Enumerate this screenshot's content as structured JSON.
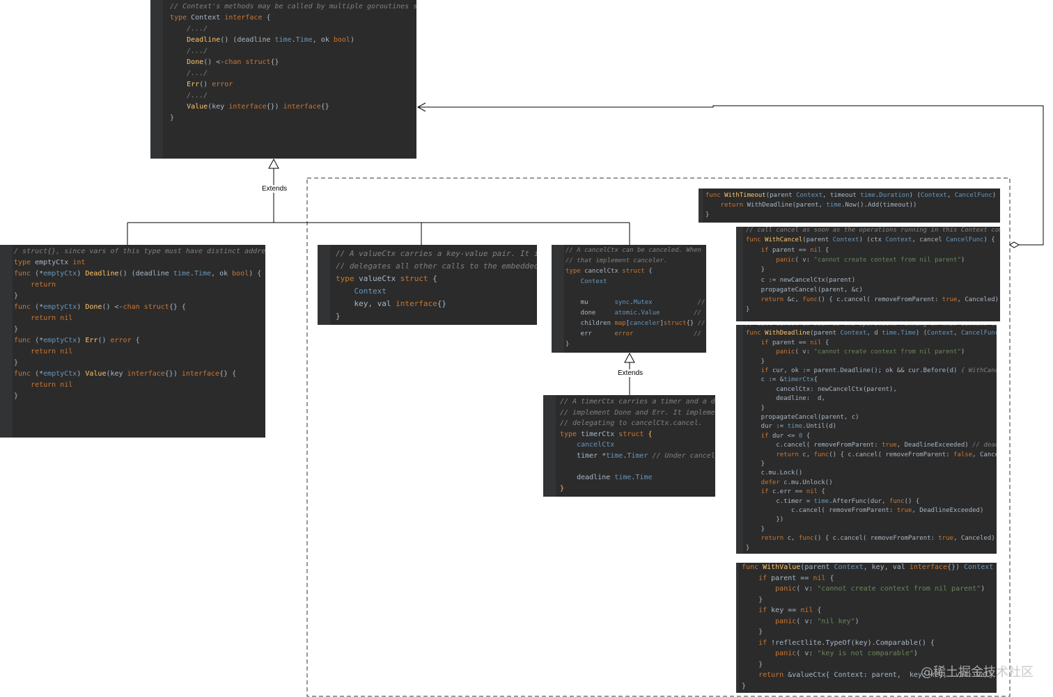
{
  "colors": {
    "panel_bg": "#2b2b2b",
    "comment": "#808080",
    "keyword": "#cc7832",
    "function": "#ffc66d",
    "type": "#6897bb",
    "plain": "#a9b7c6",
    "string": "#6a8759"
  },
  "labels": {
    "extends_top": "Extends",
    "extends_bottom": "Extends"
  },
  "watermark": "@稀土掘金技术社区",
  "panels": {
    "context_interface": [
      [
        [
          "c",
          "// Context's methods may be called by multiple goroutines si"
        ]
      ],
      [
        [
          "k",
          "type "
        ],
        [
          "p",
          "Context "
        ],
        [
          "k",
          "interface "
        ],
        [
          "p",
          "{"
        ]
      ],
      [
        [
          "c",
          "    /.../"
        ]
      ],
      [
        [
          "p",
          "    "
        ],
        [
          "f",
          "Deadline"
        ],
        [
          "p",
          "() (deadline "
        ],
        [
          "t",
          "time"
        ],
        [
          "p",
          "."
        ],
        [
          "t",
          "Time"
        ],
        [
          "p",
          ", ok "
        ],
        [
          "k",
          "bool"
        ],
        [
          "p",
          ")"
        ]
      ],
      [
        [
          "c",
          "    /.../"
        ]
      ],
      [
        [
          "p",
          "    "
        ],
        [
          "f",
          "Done"
        ],
        [
          "p",
          "() <-"
        ],
        [
          "k",
          "chan struct"
        ],
        [
          "p",
          "{}"
        ]
      ],
      [
        [
          "c",
          "    /.../"
        ]
      ],
      [
        [
          "p",
          "    "
        ],
        [
          "f",
          "Err"
        ],
        [
          "p",
          "() "
        ],
        [
          "k",
          "error"
        ]
      ],
      [
        [
          "c",
          "    /.../"
        ]
      ],
      [
        [
          "p",
          "    "
        ],
        [
          "f",
          "Value"
        ],
        [
          "p",
          "(key "
        ],
        [
          "k",
          "interface"
        ],
        [
          "p",
          "{}) "
        ],
        [
          "k",
          "interface"
        ],
        [
          "p",
          "{}"
        ]
      ],
      [
        [
          "p",
          "}"
        ]
      ]
    ],
    "empty_ctx": [
      [
        [
          "c",
          "/ struct{}, since vars of this type must have distinct addresse"
        ]
      ],
      [
        [
          "k",
          "type "
        ],
        [
          "p",
          "emptyCtx "
        ],
        [
          "k",
          "int"
        ]
      ],
      [
        [
          "k",
          "func "
        ],
        [
          "p",
          "(*"
        ],
        [
          "t",
          "emptyCtx"
        ],
        [
          "p",
          ") "
        ],
        [
          "f",
          "Deadline"
        ],
        [
          "p",
          "() (deadline "
        ],
        [
          "t",
          "time"
        ],
        [
          "p",
          "."
        ],
        [
          "t",
          "Time"
        ],
        [
          "p",
          ", ok "
        ],
        [
          "k",
          "bool"
        ],
        [
          "p",
          ") {"
        ]
      ],
      [
        [
          "k",
          "    return"
        ]
      ],
      [
        [
          "p",
          "}"
        ]
      ],
      [
        [
          "k",
          "func "
        ],
        [
          "p",
          "(*"
        ],
        [
          "t",
          "emptyCtx"
        ],
        [
          "p",
          ") "
        ],
        [
          "f",
          "Done"
        ],
        [
          "p",
          "() <-"
        ],
        [
          "k",
          "chan struct"
        ],
        [
          "p",
          "{} {"
        ]
      ],
      [
        [
          "k",
          "    return nil"
        ]
      ],
      [
        [
          "p",
          "}"
        ]
      ],
      [
        [
          "k",
          "func "
        ],
        [
          "p",
          "(*"
        ],
        [
          "t",
          "emptyCtx"
        ],
        [
          "p",
          ") "
        ],
        [
          "f",
          "Err"
        ],
        [
          "p",
          "() "
        ],
        [
          "k",
          "error "
        ],
        [
          "p",
          "{"
        ]
      ],
      [
        [
          "k",
          "    return nil"
        ]
      ],
      [
        [
          "p",
          "}"
        ]
      ],
      [
        [
          "k",
          "func "
        ],
        [
          "p",
          "(*"
        ],
        [
          "t",
          "emptyCtx"
        ],
        [
          "p",
          ") "
        ],
        [
          "f",
          "Value"
        ],
        [
          "p",
          "(key "
        ],
        [
          "k",
          "interface"
        ],
        [
          "p",
          "{}) "
        ],
        [
          "k",
          "interface"
        ],
        [
          "p",
          "{} {"
        ]
      ],
      [
        [
          "k",
          "    return nil"
        ]
      ],
      [
        [
          "p",
          "}"
        ]
      ]
    ],
    "value_ctx": [
      [
        [
          "c",
          "// A valueCtx carries a key-value pair. It i"
        ]
      ],
      [
        [
          "c",
          "// delegates all other calls to the embedded"
        ]
      ],
      [
        [
          "k",
          "type "
        ],
        [
          "p",
          "valueCtx "
        ],
        [
          "k",
          "struct "
        ],
        [
          "p",
          "{"
        ]
      ],
      [
        [
          "t",
          "    Context"
        ]
      ],
      [
        [
          "p",
          "    key, val "
        ],
        [
          "k",
          "interface"
        ],
        [
          "p",
          "{}"
        ]
      ],
      [
        [
          "p",
          "}"
        ]
      ]
    ],
    "cancel_ctx": [
      [
        [
          "c",
          "// A cancelCtx can be canceled. When"
        ]
      ],
      [
        [
          "c",
          "// that implement canceler."
        ]
      ],
      [
        [
          "k",
          "type "
        ],
        [
          "p",
          "cancelCtx "
        ],
        [
          "k",
          "struct "
        ],
        [
          "p",
          "{"
        ]
      ],
      [
        [
          "t",
          "    Context"
        ]
      ],
      [
        [
          "p",
          ""
        ]
      ],
      [
        [
          "p",
          "    mu       "
        ],
        [
          "t",
          "sync"
        ],
        [
          "p",
          "."
        ],
        [
          "t",
          "Mutex"
        ],
        [
          "c",
          "            //"
        ]
      ],
      [
        [
          "p",
          "    done     "
        ],
        [
          "t",
          "atomic"
        ],
        [
          "p",
          "."
        ],
        [
          "t",
          "Value"
        ],
        [
          "c",
          "         //"
        ]
      ],
      [
        [
          "p",
          "    children "
        ],
        [
          "k",
          "map"
        ],
        [
          "p",
          "["
        ],
        [
          "t",
          "canceler"
        ],
        [
          "p",
          "]"
        ],
        [
          "k",
          "struct"
        ],
        [
          "p",
          "{} "
        ],
        [
          "c",
          "//"
        ]
      ],
      [
        [
          "p",
          "    err      "
        ],
        [
          "k",
          "error"
        ],
        [
          "c",
          "                //"
        ]
      ],
      [
        [
          "p",
          "}"
        ]
      ]
    ],
    "timer_ctx": [
      [
        [
          "c",
          "// A timerCtx carries a timer and a dea"
        ]
      ],
      [
        [
          "c",
          "// implement Done and Err. It implement"
        ]
      ],
      [
        [
          "c",
          "// delegating to cancelCtx.cancel."
        ]
      ],
      [
        [
          "k",
          "type "
        ],
        [
          "p",
          "timerCtx "
        ],
        [
          "k",
          "struct "
        ],
        [
          "f",
          "{"
        ]
      ],
      [
        [
          "t",
          "    cancelCtx"
        ]
      ],
      [
        [
          "p",
          "    timer *"
        ],
        [
          "t",
          "time"
        ],
        [
          "p",
          "."
        ],
        [
          "t",
          "Timer"
        ],
        [
          "c",
          " // Under cancelCt"
        ]
      ],
      [
        [
          "p",
          ""
        ]
      ],
      [
        [
          "p",
          "    deadline "
        ],
        [
          "t",
          "time"
        ],
        [
          "p",
          "."
        ],
        [
          "t",
          "Time"
        ]
      ],
      [
        [
          "f",
          "}"
        ]
      ]
    ],
    "with_timeout": [
      [
        [
          "k",
          "func "
        ],
        [
          "f",
          "WithTimeout"
        ],
        [
          "p",
          "(parent "
        ],
        [
          "t",
          "Context"
        ],
        [
          "p",
          ", timeout "
        ],
        [
          "t",
          "time"
        ],
        [
          "p",
          "."
        ],
        [
          "t",
          "Duration"
        ],
        [
          "p",
          ") ("
        ],
        [
          "t",
          "Context"
        ],
        [
          "p",
          ", "
        ],
        [
          "t",
          "CancelFunc"
        ],
        [
          "p",
          ") {"
        ]
      ],
      [
        [
          "k",
          "    return "
        ],
        [
          "p",
          "WithDeadline(parent, "
        ],
        [
          "t",
          "time"
        ],
        [
          "p",
          ".Now().Add(timeout))"
        ]
      ],
      [
        [
          "p",
          "}"
        ]
      ]
    ],
    "with_cancel": [
      [
        [
          "c",
          "// call cancel as soon as the operations running in this Context com"
        ]
      ],
      [
        [
          "k",
          "func "
        ],
        [
          "f",
          "WithCancel"
        ],
        [
          "p",
          "(parent "
        ],
        [
          "t",
          "Context"
        ],
        [
          "p",
          ") (ctx "
        ],
        [
          "t",
          "Context"
        ],
        [
          "p",
          ", cancel "
        ],
        [
          "t",
          "CancelFunc"
        ],
        [
          "p",
          ") {"
        ]
      ],
      [
        [
          "k",
          "    if "
        ],
        [
          "p",
          "parent == "
        ],
        [
          "k",
          "nil "
        ],
        [
          "p",
          "{"
        ]
      ],
      [
        [
          "k",
          "        panic"
        ],
        [
          "p",
          "( v: "
        ],
        [
          "s",
          "\"cannot create context from nil parent\""
        ],
        [
          "p",
          ")"
        ]
      ],
      [
        [
          "p",
          "    }"
        ]
      ],
      [
        [
          "p",
          "    c := newCancelCtx(parent)"
        ]
      ],
      [
        [
          "p",
          "    propagateCancel(parent, &c)"
        ]
      ],
      [
        [
          "k",
          "    return "
        ],
        [
          "p",
          "&c, "
        ],
        [
          "k",
          "func"
        ],
        [
          "p",
          "() { c.cancel( removeFromParent: "
        ],
        [
          "k",
          "true"
        ],
        [
          "p",
          ", Canceled) }"
        ]
      ],
      [
        [
          "p",
          "}"
        ]
      ]
    ],
    "with_deadline": [
      [
        [
          "c",
          "// call cancel as soon as the operations running in this Context complete"
        ]
      ],
      [
        [
          "k",
          "func "
        ],
        [
          "f",
          "WithDeadline"
        ],
        [
          "p",
          "(parent "
        ],
        [
          "t",
          "Context"
        ],
        [
          "p",
          ", d "
        ],
        [
          "t",
          "time"
        ],
        [
          "p",
          "."
        ],
        [
          "t",
          "Time"
        ],
        [
          "p",
          ") ("
        ],
        [
          "t",
          "Context"
        ],
        [
          "p",
          ", "
        ],
        [
          "t",
          "CancelFunc"
        ],
        [
          "p",
          ") {"
        ]
      ],
      [
        [
          "k",
          "    if "
        ],
        [
          "p",
          "parent == "
        ],
        [
          "k",
          "nil "
        ],
        [
          "p",
          "{"
        ]
      ],
      [
        [
          "k",
          "        panic"
        ],
        [
          "p",
          "( v: "
        ],
        [
          "s",
          "\"cannot create context from nil parent\""
        ],
        [
          "p",
          ")"
        ]
      ],
      [
        [
          "p",
          "    }"
        ]
      ],
      [
        [
          "k",
          "    if "
        ],
        [
          "p",
          "cur, ok := parent.Deadline(); ok && cur.Before(d) "
        ],
        [
          "c",
          "{ WithCancel(pa"
        ]
      ],
      [
        [
          "p",
          "    c := &"
        ],
        [
          "t",
          "timerCtx"
        ],
        [
          "p",
          "{"
        ]
      ],
      [
        [
          "p",
          "        cancelCtx: newCancelCtx(parent),"
        ]
      ],
      [
        [
          "p",
          "        deadline:  d,"
        ]
      ],
      [
        [
          "p",
          "    }"
        ]
      ],
      [
        [
          "p",
          "    propagateCancel(parent, c)"
        ]
      ],
      [
        [
          "p",
          "    dur := "
        ],
        [
          "t",
          "time"
        ],
        [
          "p",
          ".Until(d)"
        ]
      ],
      [
        [
          "k",
          "    if "
        ],
        [
          "p",
          "dur <= "
        ],
        [
          "t",
          "0 "
        ],
        [
          "p",
          "{"
        ]
      ],
      [
        [
          "p",
          "        c.cancel( removeFromParent: "
        ],
        [
          "k",
          "true"
        ],
        [
          "p",
          ", DeadlineExceeded) "
        ],
        [
          "c",
          "// deadline has"
        ]
      ],
      [
        [
          "k",
          "        return "
        ],
        [
          "p",
          "c, "
        ],
        [
          "k",
          "func"
        ],
        [
          "p",
          "() { c.cancel( removeFromParent: "
        ],
        [
          "k",
          "false"
        ],
        [
          "p",
          ", Canceled) }"
        ]
      ],
      [
        [
          "p",
          "    }"
        ]
      ],
      [
        [
          "p",
          "    c.mu.Lock()"
        ]
      ],
      [
        [
          "k",
          "    defer "
        ],
        [
          "p",
          "c.mu.Unlock()"
        ]
      ],
      [
        [
          "k",
          "    if "
        ],
        [
          "p",
          "c.err == "
        ],
        [
          "k",
          "nil "
        ],
        [
          "p",
          "{"
        ]
      ],
      [
        [
          "p",
          "        c.timer = "
        ],
        [
          "t",
          "time"
        ],
        [
          "p",
          ".AfterFunc(dur, "
        ],
        [
          "k",
          "func"
        ],
        [
          "p",
          "() {"
        ]
      ],
      [
        [
          "p",
          "            c.cancel( removeFromParent: "
        ],
        [
          "k",
          "true"
        ],
        [
          "p",
          ", DeadlineExceeded)"
        ]
      ],
      [
        [
          "p",
          "        })"
        ]
      ],
      [
        [
          "p",
          "    }"
        ]
      ],
      [
        [
          "k",
          "    return "
        ],
        [
          "p",
          "c, "
        ],
        [
          "k",
          "func"
        ],
        [
          "p",
          "() { c.cancel( removeFromParent: "
        ],
        [
          "k",
          "true"
        ],
        [
          "p",
          ", Canceled) }"
        ]
      ],
      [
        [
          "p",
          "}"
        ]
      ]
    ],
    "with_value": [
      [
        [
          "k",
          "func "
        ],
        [
          "f",
          "WithValue"
        ],
        [
          "p",
          "(parent "
        ],
        [
          "t",
          "Context"
        ],
        [
          "p",
          ", key, val "
        ],
        [
          "k",
          "interface"
        ],
        [
          "p",
          "{}) "
        ],
        [
          "t",
          "Context "
        ],
        [
          "p",
          "{"
        ]
      ],
      [
        [
          "k",
          "    if "
        ],
        [
          "p",
          "parent == "
        ],
        [
          "k",
          "nil "
        ],
        [
          "p",
          "{"
        ]
      ],
      [
        [
          "k",
          "        panic"
        ],
        [
          "p",
          "( v: "
        ],
        [
          "s",
          "\"cannot create context from nil parent\""
        ],
        [
          "p",
          ")"
        ]
      ],
      [
        [
          "p",
          "    }"
        ]
      ],
      [
        [
          "k",
          "    if "
        ],
        [
          "p",
          "key == "
        ],
        [
          "k",
          "nil "
        ],
        [
          "p",
          "{"
        ]
      ],
      [
        [
          "k",
          "        panic"
        ],
        [
          "p",
          "( v: "
        ],
        [
          "s",
          "\"nil key\""
        ],
        [
          "p",
          ")"
        ]
      ],
      [
        [
          "p",
          "    }"
        ]
      ],
      [
        [
          "k",
          "    if "
        ],
        [
          "p",
          "!reflectlite.TypeOf(key).Comparable() {"
        ]
      ],
      [
        [
          "k",
          "        panic"
        ],
        [
          "p",
          "( v: "
        ],
        [
          "s",
          "\"key is not comparable\""
        ],
        [
          "p",
          ")"
        ]
      ],
      [
        [
          "p",
          "    }"
        ]
      ],
      [
        [
          "k",
          "    return "
        ],
        [
          "p",
          "&valueCtx{ Context: parent,  key: key,  val: val}"
        ]
      ],
      [
        [
          "p",
          "}"
        ]
      ]
    ]
  }
}
